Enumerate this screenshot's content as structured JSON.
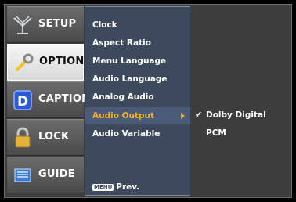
{
  "tabs": [
    {
      "label": "SETUP",
      "icon": "antenna-icon",
      "selected": false
    },
    {
      "label": "OPTION",
      "icon": "wrench-icon",
      "selected": true
    },
    {
      "label": "CAPTION",
      "icon": "caption-d-icon",
      "selected": false
    },
    {
      "label": "LOCK",
      "icon": "padlock-icon",
      "selected": false
    },
    {
      "label": "GUIDE",
      "icon": "book-icon",
      "selected": false
    }
  ],
  "menu": {
    "items": [
      {
        "label": "Clock"
      },
      {
        "label": "Aspect Ratio"
      },
      {
        "label": "Menu Language"
      },
      {
        "label": "Audio Language"
      },
      {
        "label": "Analog Audio"
      },
      {
        "label": "Audio Output",
        "highlighted": true
      },
      {
        "label": "Audio Variable"
      }
    ],
    "hint_badge": "MENU",
    "hint_label": "Prev."
  },
  "options": [
    {
      "label": "Dolby Digital",
      "checked": true,
      "check": "✔"
    },
    {
      "label": "PCM",
      "checked": false,
      "check": ""
    }
  ],
  "colors": {
    "accent": "#f2b01e",
    "menu_bg": "#3d4a5e",
    "highlight_bg": "#4b5a78"
  }
}
